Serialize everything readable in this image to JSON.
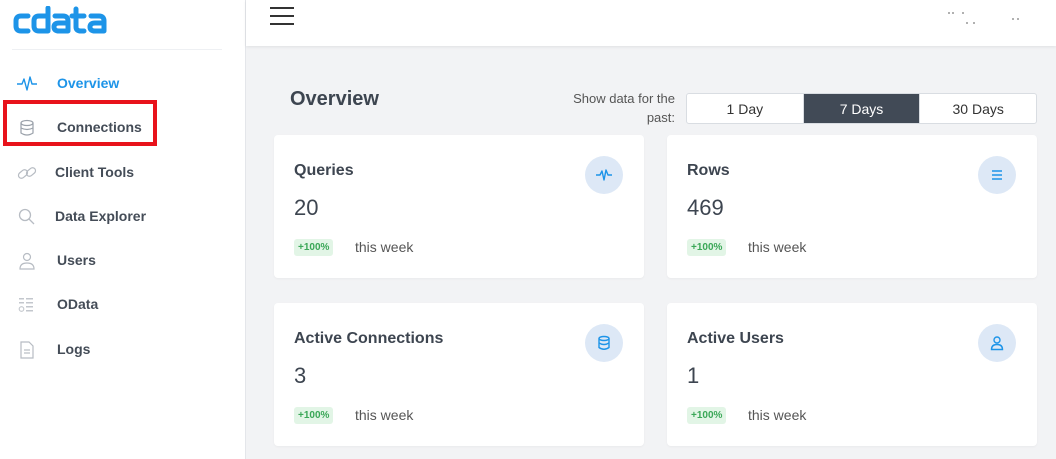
{
  "brand": {
    "logo_text": "cdata",
    "color": "#1d94e8"
  },
  "sidebar": {
    "items": [
      {
        "label": "Overview",
        "icon": "pulse-icon",
        "active": true
      },
      {
        "label": "Connections",
        "icon": "database-icon",
        "active": false
      },
      {
        "label": "Client Tools",
        "icon": "link-icon",
        "active": false
      },
      {
        "label": "Data Explorer",
        "icon": "search-icon",
        "active": false
      },
      {
        "label": "Users",
        "icon": "user-icon",
        "active": false
      },
      {
        "label": "OData",
        "icon": "odata-icon",
        "active": false
      },
      {
        "label": "Logs",
        "icon": "file-icon",
        "active": false
      }
    ]
  },
  "header": {
    "menu_icon": "hamburger-icon"
  },
  "main": {
    "title": "Overview",
    "range_label": "Show data for the past:",
    "range_options": [
      "1 Day",
      "7 Days",
      "30 Days"
    ],
    "selected_range": "7 Days",
    "cards": [
      {
        "title": "Queries",
        "value": "20",
        "badge": "+100%",
        "period": "this week",
        "icon": "pulse-icon"
      },
      {
        "title": "Rows",
        "value": "469",
        "badge": "+100%",
        "period": "this week",
        "icon": "list-icon"
      },
      {
        "title": "Active Connections",
        "value": "3",
        "badge": "+100%",
        "period": "this week",
        "icon": "database-icon"
      },
      {
        "title": "Active Users",
        "value": "1",
        "badge": "+100%",
        "period": "this week",
        "icon": "user-icon"
      }
    ]
  },
  "colors": {
    "accent": "#1d94e8",
    "selected_bg": "#414a56",
    "badge_green": "#3aa757",
    "badge_bg": "#e2f5e6",
    "highlight": "#e8121b",
    "icon_bg": "#dde8f6"
  }
}
